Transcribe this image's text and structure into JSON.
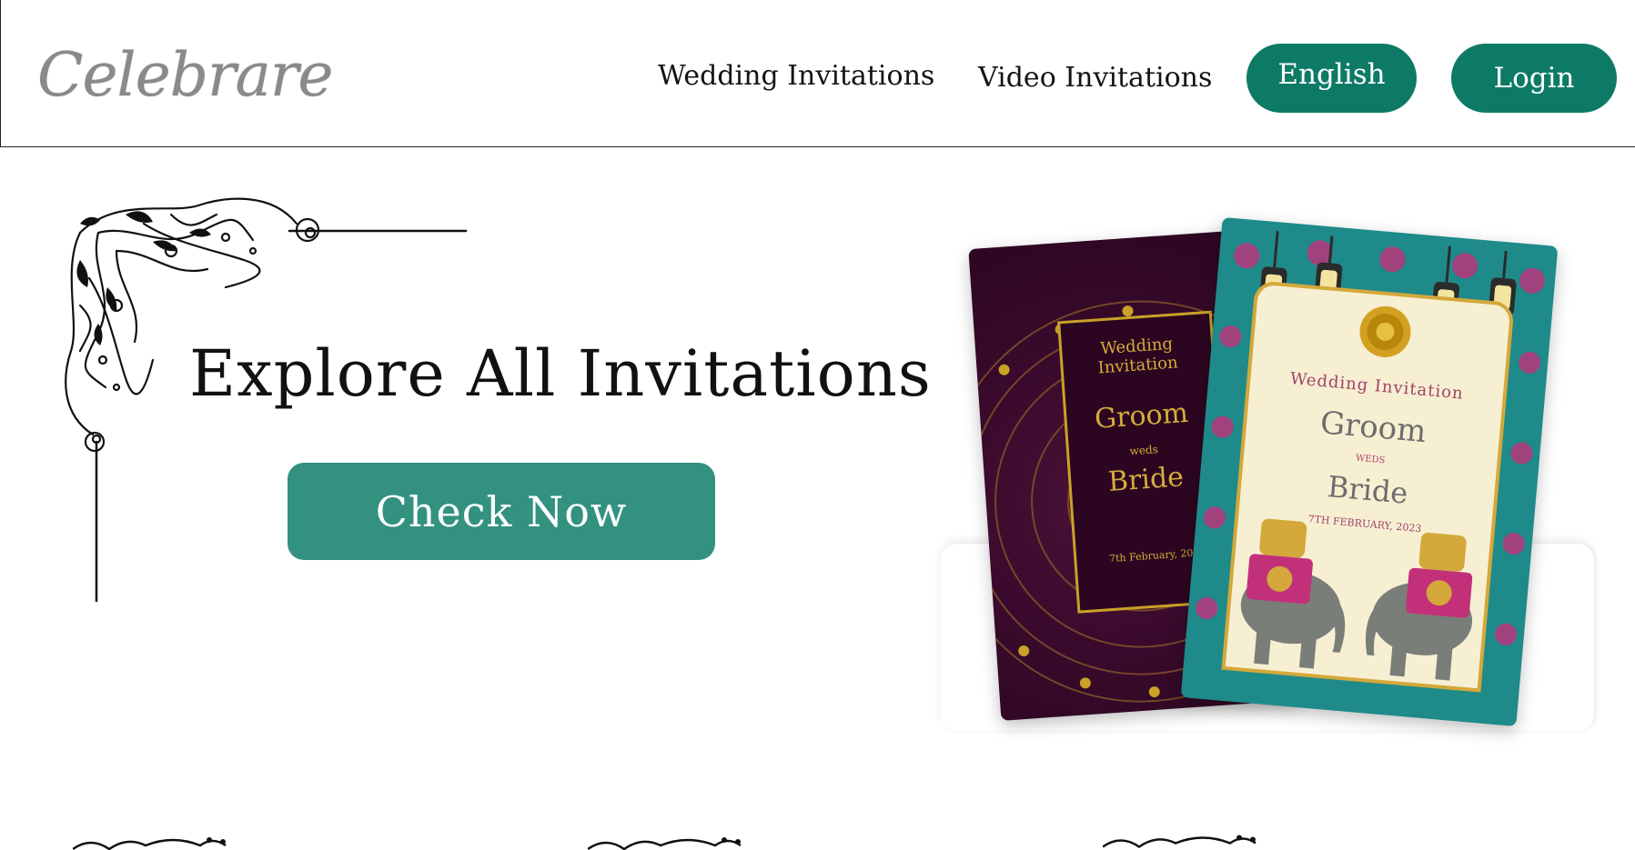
{
  "header": {
    "logo": "Celebrare",
    "nav": {
      "wedding": "Wedding Invitations",
      "video": "Video Invitations"
    },
    "language_button": "English",
    "login_button": "Login"
  },
  "hero": {
    "title": "Explore All Invitations",
    "cta": "Check Now"
  },
  "cards": {
    "dark": {
      "heading": "Wedding Invitation",
      "groom": "Groom",
      "weds": "weds",
      "bride": "Bride",
      "date": "7th February, 20"
    },
    "light": {
      "heading": "Wedding Invitation",
      "groom": "Groom",
      "weds": "WEDS",
      "bride": "Bride",
      "date": "7TH FEBRUARY, 2023"
    }
  },
  "colors": {
    "brand_green": "#0d7a66",
    "cta_green": "#339180",
    "card_plum": "#3a0a2c",
    "card_teal": "#1f8a8a",
    "gold": "#c9a227"
  }
}
